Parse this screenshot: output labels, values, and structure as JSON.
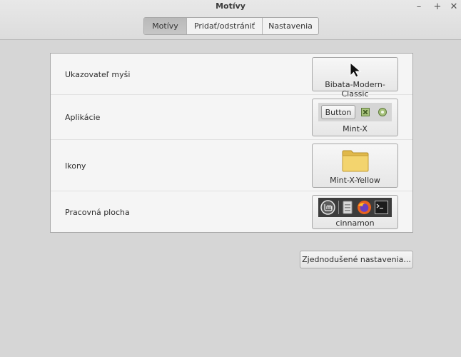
{
  "window": {
    "title": "Motívy",
    "minimize_glyph": "–",
    "maximize_glyph": "+",
    "close_glyph": "✕"
  },
  "tabs": [
    {
      "label": "Motívy",
      "active": true
    },
    {
      "label": "Pridať/odstrániť",
      "active": false
    },
    {
      "label": "Nastavenia",
      "active": false
    }
  ],
  "themes": {
    "cursor": {
      "label": "Ukazovateľ myši",
      "value": "Bibata-Modern-Classic",
      "icon": "cursor-arrow-icon"
    },
    "applications": {
      "label": "Aplikácie",
      "value": "Mint-X",
      "preview_button": "Button",
      "icon": "gtk-preview"
    },
    "icons": {
      "label": "Ikony",
      "value": "Mint-X-Yellow",
      "icon": "folder-icon"
    },
    "desktop": {
      "label": "Pracovná plocha",
      "value": "cinnamon",
      "icon": "panel-preview"
    }
  },
  "buttons": {
    "simplified_settings": "Zjednodušené nastavenia..."
  },
  "colors": {
    "folder": "#f3d46e",
    "check_accent": "#a7c27c",
    "firefox": "#e8621f"
  }
}
